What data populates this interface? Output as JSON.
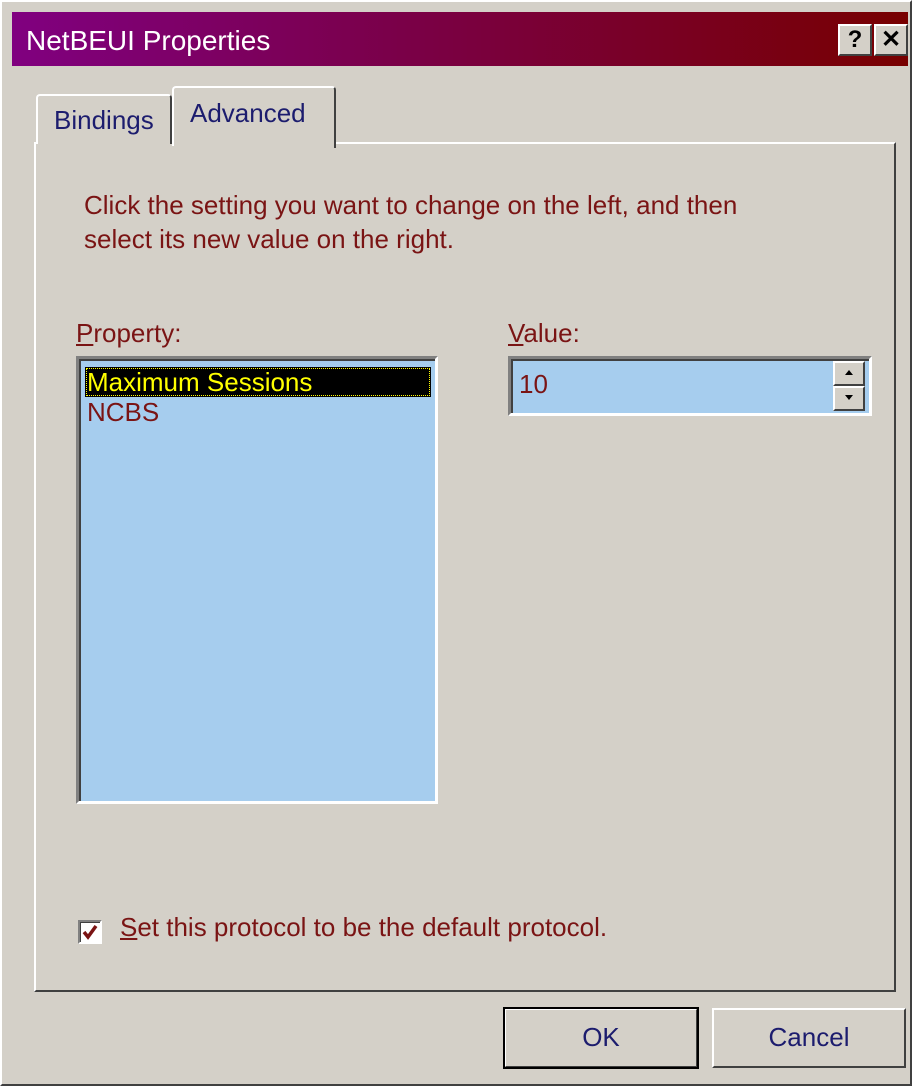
{
  "window": {
    "title": "NetBEUI Properties",
    "help_glyph": "?",
    "close_glyph": "✕"
  },
  "tabs": [
    {
      "label": "Bindings",
      "active": false
    },
    {
      "label": "Advanced",
      "active": true
    }
  ],
  "advanced": {
    "instructions": "Click the setting you want to change on the left, and then select its new value on the right.",
    "property_label_access": "P",
    "property_label_rest": "roperty:",
    "value_label_access": "V",
    "value_label_rest": "alue:",
    "properties": [
      {
        "label": "Maximum Sessions",
        "selected": true
      },
      {
        "label": "NCBS",
        "selected": false
      }
    ],
    "value": "10",
    "default_protocol": {
      "checked": true,
      "label_access": "S",
      "label_rest": "et this protocol to be the default protocol."
    }
  },
  "buttons": {
    "ok": "OK",
    "cancel": "Cancel"
  },
  "colors": {
    "face": "#d4d0c8",
    "title_gradient_start": "#800080",
    "title_gradient_end": "#780000",
    "field_background": "#a6cdee",
    "text_dark_red": "#7a1414",
    "selection_bg": "#000000",
    "selection_fg": "#ffff00"
  }
}
